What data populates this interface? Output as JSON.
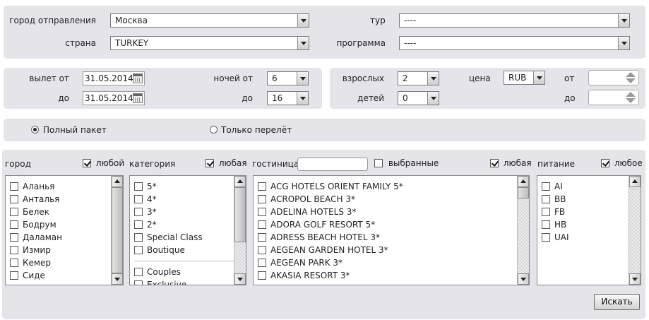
{
  "top": {
    "departure_city": {
      "label": "город отправления",
      "value": "Москва"
    },
    "tour": {
      "label": "тур",
      "value": "----"
    },
    "country": {
      "label": "страна",
      "value": "TURKEY"
    },
    "program": {
      "label": "программа",
      "value": "----"
    }
  },
  "dates": {
    "depart_from_label": "вылет от",
    "depart_from": "31.05.2014",
    "to_label": "до",
    "depart_to": "31.05.2014",
    "nights_from_label": "ночей от",
    "nights_from": "6",
    "nights_to_label": "до",
    "nights_to": "16"
  },
  "people": {
    "adults_label": "взрослых",
    "adults": "2",
    "children_label": "детей",
    "children": "0",
    "price_label": "цена",
    "currency": "RUB",
    "price_from_label": "от",
    "price_to_label": "до"
  },
  "package": {
    "full_label": "Полный пакет",
    "flight_label": "Только перелёт",
    "selected": "full"
  },
  "filters": {
    "city": {
      "header": "город",
      "any_label": "любой",
      "items": [
        "Аланья",
        "Анталья",
        "Белек",
        "Бодрум",
        "Даламан",
        "Измир",
        "Кемер",
        "Сиде"
      ]
    },
    "category": {
      "header": "категория",
      "any_label": "любая",
      "items": [
        "5*",
        "4*",
        "3*",
        "2*",
        "Special Class",
        "Boutique"
      ],
      "items2": [
        "Couples",
        "Exclusive"
      ]
    },
    "hotel": {
      "header": "гостиница",
      "selected_label": "выбранные",
      "any_label": "любая",
      "items": [
        "ACG HOTELS ORIENT FAMILY 5*",
        "ACROPOL BEACH 3*",
        "ADELINA HOTELS 3*",
        "ADORA GOLF RESORT 5*",
        "ADRESS BEACH HOTEL 3*",
        "AEGEAN GARDEN HOTEL 3*",
        "AEGEAN PARK 3*",
        "AKASIA RESORT 3*"
      ]
    },
    "meal": {
      "header": "питание",
      "any_label": "любое",
      "items": [
        "AI",
        "BB",
        "FB",
        "HB",
        "UAI"
      ]
    }
  },
  "search_button": "Искать"
}
